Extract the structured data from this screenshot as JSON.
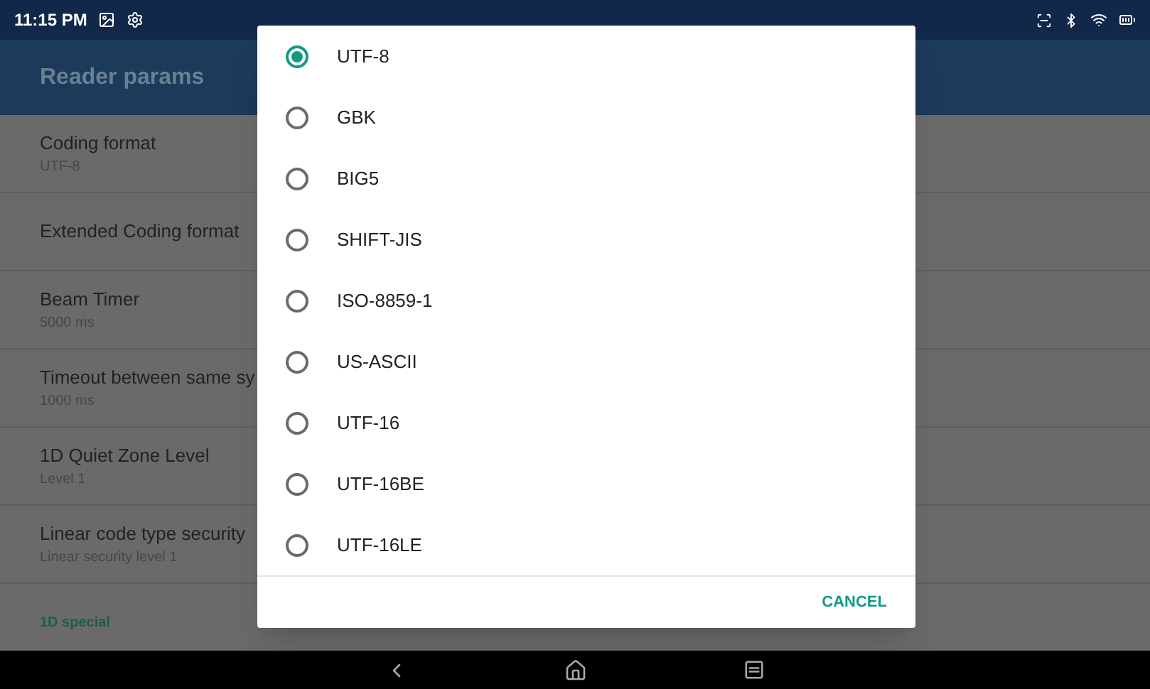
{
  "status_bar": {
    "time": "11:15 PM"
  },
  "app_bar": {
    "title": "Reader params"
  },
  "settings": [
    {
      "kind": "item",
      "title": "Coding format",
      "summary": "UTF-8"
    },
    {
      "kind": "item",
      "title": "Extended Coding format"
    },
    {
      "kind": "item",
      "title": "Beam Timer",
      "summary": "5000 ms"
    },
    {
      "kind": "item",
      "title": "Timeout between same sy",
      "summary": "1000 ms"
    },
    {
      "kind": "item",
      "title": "1D Quiet Zone Level",
      "summary": "Level 1"
    },
    {
      "kind": "item",
      "title": "Linear code type security",
      "summary": "Linear security level 1"
    },
    {
      "kind": "category",
      "title": "1D special"
    }
  ],
  "dialog": {
    "options": [
      {
        "label": "UTF-8",
        "selected": true
      },
      {
        "label": "GBK",
        "selected": false
      },
      {
        "label": "BIG5",
        "selected": false
      },
      {
        "label": "SHIFT-JIS",
        "selected": false
      },
      {
        "label": "ISO-8859-1",
        "selected": false
      },
      {
        "label": "US-ASCII",
        "selected": false
      },
      {
        "label": "UTF-16",
        "selected": false
      },
      {
        "label": "UTF-16BE",
        "selected": false
      },
      {
        "label": "UTF-16LE",
        "selected": false
      }
    ],
    "buttons": [
      "CANCEL"
    ]
  }
}
